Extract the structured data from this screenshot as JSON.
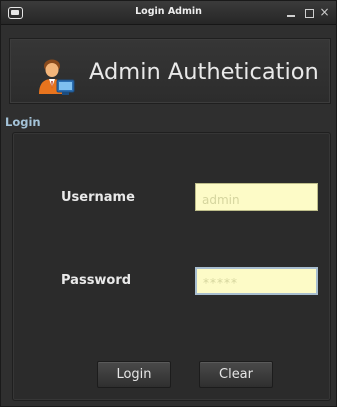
{
  "window": {
    "title": "Login Admin",
    "icons": {
      "app": "window-icon",
      "minimize": "minimize-icon",
      "maximize": "maximize-icon",
      "close": "close-icon"
    },
    "close_glyph": "×"
  },
  "header": {
    "title": "Admin Authetication",
    "icon": "admin-user-icon"
  },
  "login_group": {
    "title": "Login",
    "username_label": "Username",
    "username_value": "admin",
    "password_label": "Password",
    "password_value": "*****",
    "login_button": "Login",
    "clear_button": "Clear"
  },
  "colors": {
    "window_bg": "#2f2f2f",
    "field_bg": "#fdfbc7",
    "group_title": "#a4c3d8",
    "text": "#e9e9e9"
  }
}
